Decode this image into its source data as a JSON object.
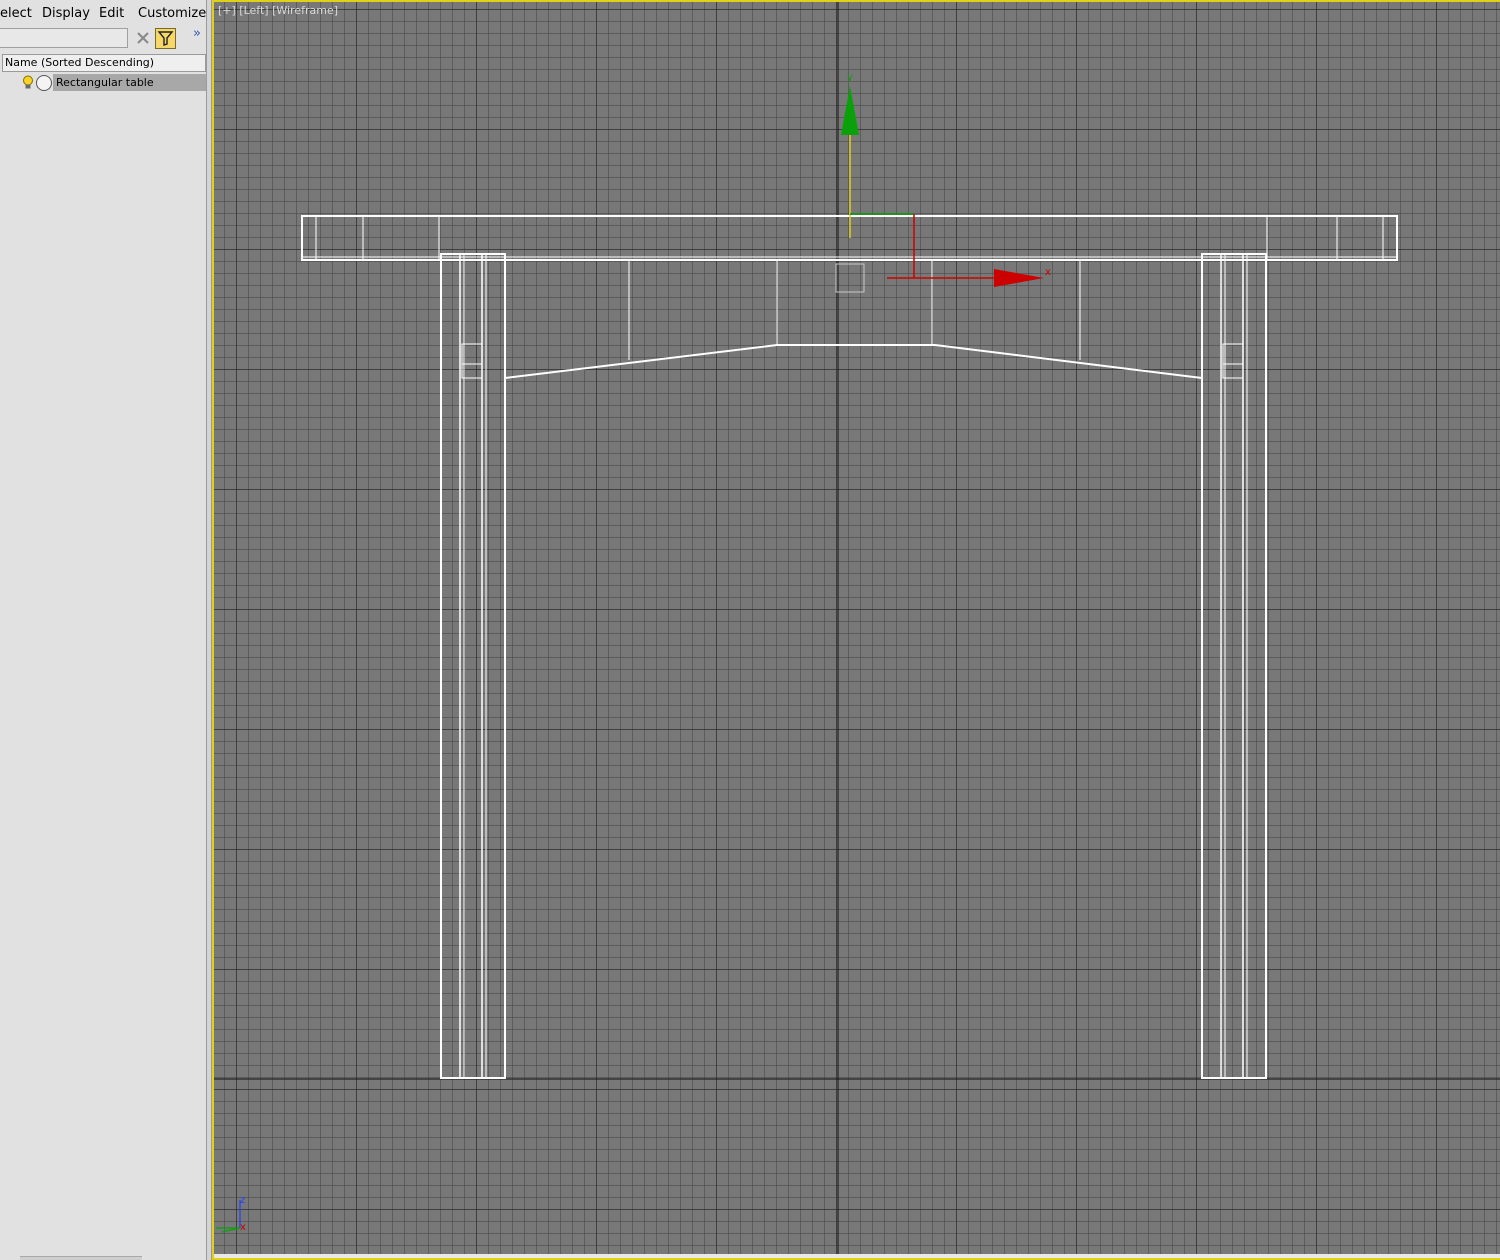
{
  "menu": {
    "select": "elect",
    "display": "Display",
    "edit": "Edit",
    "customize": "Customize"
  },
  "search": {
    "value": ""
  },
  "tree": {
    "column_header": "Name (Sorted Descending)",
    "rows": [
      {
        "label": "Rectangular table"
      }
    ]
  },
  "viewport": {
    "label": "[+] [Left] [Wireframe]",
    "gizmo": {
      "x_label": "x",
      "y_label": "y"
    },
    "axis_tripod": {
      "z_label": "z",
      "x_label": "x"
    }
  },
  "colors": {
    "viewport_border": "#e0d018",
    "x_axis": "#cc0000",
    "y_axis": "#0aa00a",
    "z_axis": "#2040ff",
    "wire": "#ffffff"
  }
}
